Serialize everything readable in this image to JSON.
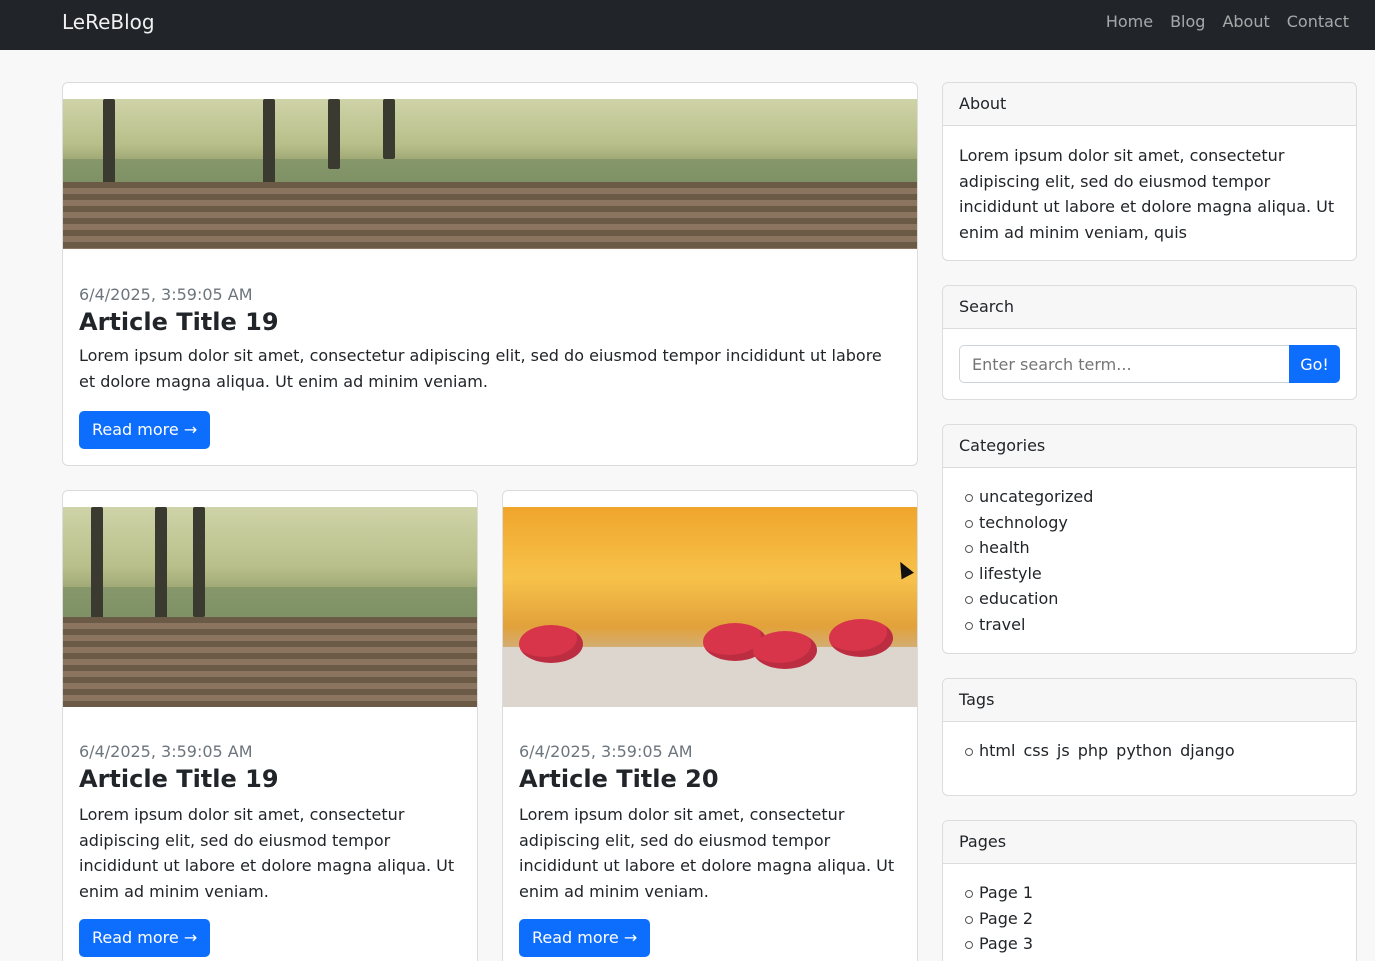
{
  "navbar": {
    "brand": "LeReBlog",
    "links": [
      "Home",
      "Blog",
      "About",
      "Contact"
    ]
  },
  "featured": {
    "date": "6/4/2025, 3:59:05 AM",
    "title": "Article Title 19",
    "excerpt": "Lorem ipsum dolor sit amet, consectetur adipiscing elit, sed do eiusmod tempor incididunt ut labore et dolore magna aliqua. Ut enim ad minim veniam.",
    "button": "Read more →",
    "image": "railway-tracks-photo"
  },
  "posts": [
    {
      "date": "6/4/2025, 3:59:05 AM",
      "title": "Article Title 19",
      "excerpt": "Lorem ipsum dolor sit amet, consectetur adipiscing elit, sed do eiusmod tempor incididunt ut labore et dolore magna aliqua. Ut enim ad minim veniam.",
      "button": "Read more →",
      "image": "railway-tracks-photo"
    },
    {
      "date": "6/4/2025, 3:59:05 AM",
      "title": "Article Title 20",
      "excerpt": "Lorem ipsum dolor sit amet, consectetur adipiscing elit, sed do eiusmod tempor incididunt ut labore et dolore magna aliqua. Ut enim ad minim veniam.",
      "button": "Read more →",
      "image": "raspberries-photo"
    }
  ],
  "sidebar": {
    "about": {
      "heading": "About",
      "text": "Lorem ipsum dolor sit amet, consectetur adipiscing elit, sed do eiusmod tempor incididunt ut labore et dolore magna aliqua. Ut enim ad minim veniam, quis"
    },
    "search": {
      "heading": "Search",
      "placeholder": "Enter search term...",
      "button": "Go!"
    },
    "categories": {
      "heading": "Categories",
      "items": [
        "uncategorized",
        "technology",
        "health",
        "lifestyle",
        "education",
        "travel"
      ]
    },
    "tags": {
      "heading": "Tags",
      "items": [
        "html",
        "css",
        "js",
        "php",
        "python",
        "django"
      ]
    },
    "pages": {
      "heading": "Pages",
      "items": [
        "Page 1",
        "Page 2",
        "Page 3"
      ]
    }
  },
  "colors": {
    "navbar_bg": "#212529",
    "primary": "#0d6efd",
    "page_bg": "#f8f8f8"
  }
}
